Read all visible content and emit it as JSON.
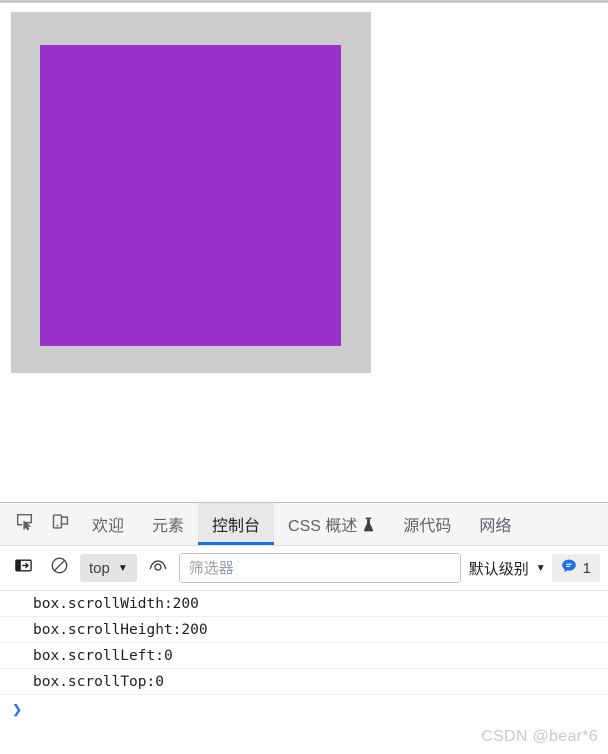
{
  "page": {
    "scroll_box": {
      "name": "box",
      "bg_color": "#cccccc"
    },
    "inner_box": {
      "bg_color": "#9932cc"
    }
  },
  "devtools": {
    "toolbar_icons": [
      {
        "name": "inspect-element-icon",
        "title": "inspect"
      },
      {
        "name": "device-toolbar-icon",
        "title": "device"
      }
    ],
    "tabs": [
      {
        "id": "welcome",
        "label": "欢迎",
        "active": false,
        "experimental": false
      },
      {
        "id": "elements",
        "label": "元素",
        "active": false,
        "experimental": false
      },
      {
        "id": "console",
        "label": "控制台",
        "active": true,
        "experimental": false
      },
      {
        "id": "css-overview",
        "label": "CSS 概述",
        "active": false,
        "experimental": true
      },
      {
        "id": "sources",
        "label": "源代码",
        "active": false,
        "experimental": false
      },
      {
        "id": "network",
        "label": "网络",
        "active": false,
        "experimental": false
      }
    ],
    "console_toolbar": {
      "sidebar_toggle_icon": "sidebar-toggle-icon",
      "clear_console_icon": "clear-console-icon",
      "context_value": "top",
      "context_caret": "▼",
      "live_expression_icon": "eye-icon",
      "filter_placeholder": "筛选器",
      "filter_value": "",
      "level_label": "默认级别",
      "level_caret": "▼",
      "message_icon": "info-bubble-icon",
      "message_count": "1"
    },
    "console_messages": [
      "box.scrollWidth:200",
      "box.scrollHeight:200",
      "box.scrollLeft:0",
      "box.scrollTop:0"
    ],
    "prompt_symbol": "❯"
  },
  "watermark": {
    "text": "CSDN @bear*6"
  },
  "colors": {
    "accent_blue": "#1a73e8",
    "purple_box": "#9932cc",
    "gray_box": "#cccccc"
  }
}
